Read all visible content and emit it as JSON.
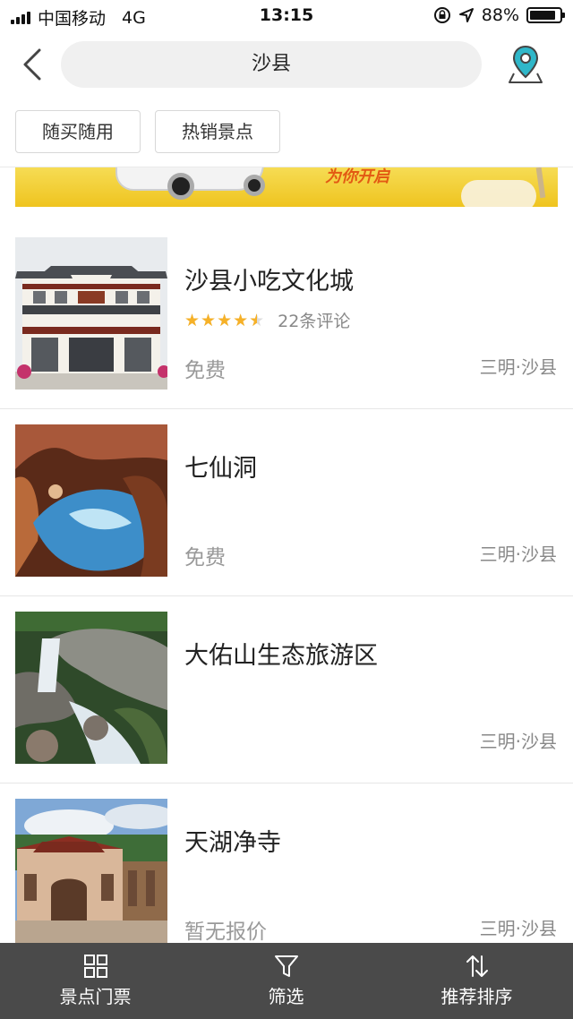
{
  "status_bar": {
    "carrier": "中国移动",
    "network": "4G",
    "time": "13:15",
    "battery": "88%",
    "battery_level": 0.88
  },
  "header": {
    "search_text": "沙县",
    "back_icon": "chevron-left-icon",
    "map_icon": "map-pin-icon"
  },
  "filters": [
    "随买随用",
    "热销景点"
  ],
  "banner": {
    "slogan": "为你开启"
  },
  "colors": {
    "star": "#f6b128",
    "tabbar": "#4a4a4a",
    "muted": "#999999"
  },
  "items": [
    {
      "name": "沙县小吃文化城",
      "rating": 4.5,
      "reviews": "22条评论",
      "price": "免费",
      "location": "三明·沙县"
    },
    {
      "name": "七仙洞",
      "price": "免费",
      "location": "三明·沙县"
    },
    {
      "name": "大佑山生态旅游区",
      "price": "",
      "location": "三明·沙县"
    },
    {
      "name": "天湖净寺",
      "price": "暂无报价",
      "location": "三明·沙县"
    }
  ],
  "tabbar": [
    {
      "label": "景点门票",
      "icon": "grid-icon"
    },
    {
      "label": "筛选",
      "icon": "filter-icon"
    },
    {
      "label": "推荐排序",
      "icon": "sort-icon"
    }
  ]
}
